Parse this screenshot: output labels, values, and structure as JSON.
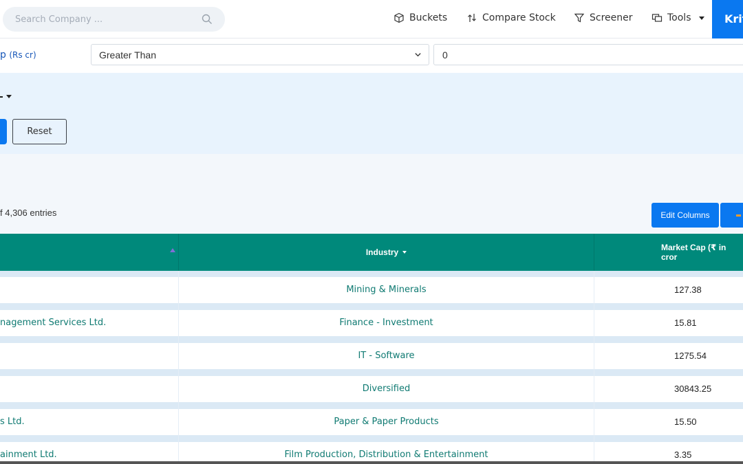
{
  "search": {
    "placeholder": "Search Company ..."
  },
  "nav": {
    "buckets": "Buckets",
    "compare": "Compare Stock",
    "screener": "Screener",
    "tools": "Tools",
    "user": "Krit"
  },
  "filter": {
    "label": "p",
    "unit": "(Rs cr)",
    "operator": "Greater Than",
    "value": "0"
  },
  "panel": {
    "reset_label": "Reset"
  },
  "entries_text": "f 4,306 entries",
  "buttons": {
    "edit_columns": "Edit Columns"
  },
  "table": {
    "headers": {
      "industry": "Industry",
      "market_cap": "Market Cap (₹ in cror"
    },
    "rows": [
      {
        "name": "",
        "industry": "Mining & Minerals",
        "market_cap": "127.38"
      },
      {
        "name": "nagement Services Ltd.",
        "industry": "Finance - Investment",
        "market_cap": "15.81"
      },
      {
        "name": "",
        "industry": "IT - Software",
        "market_cap": "1275.54"
      },
      {
        "name": "",
        "industry": "Diversified",
        "market_cap": "30843.25"
      },
      {
        "name": "s Ltd.",
        "industry": "Paper & Paper Products",
        "market_cap": "15.50"
      },
      {
        "name": "ainment Ltd.",
        "industry": "Film Production, Distribution & Entertainment",
        "market_cap": "3.35"
      }
    ]
  }
}
